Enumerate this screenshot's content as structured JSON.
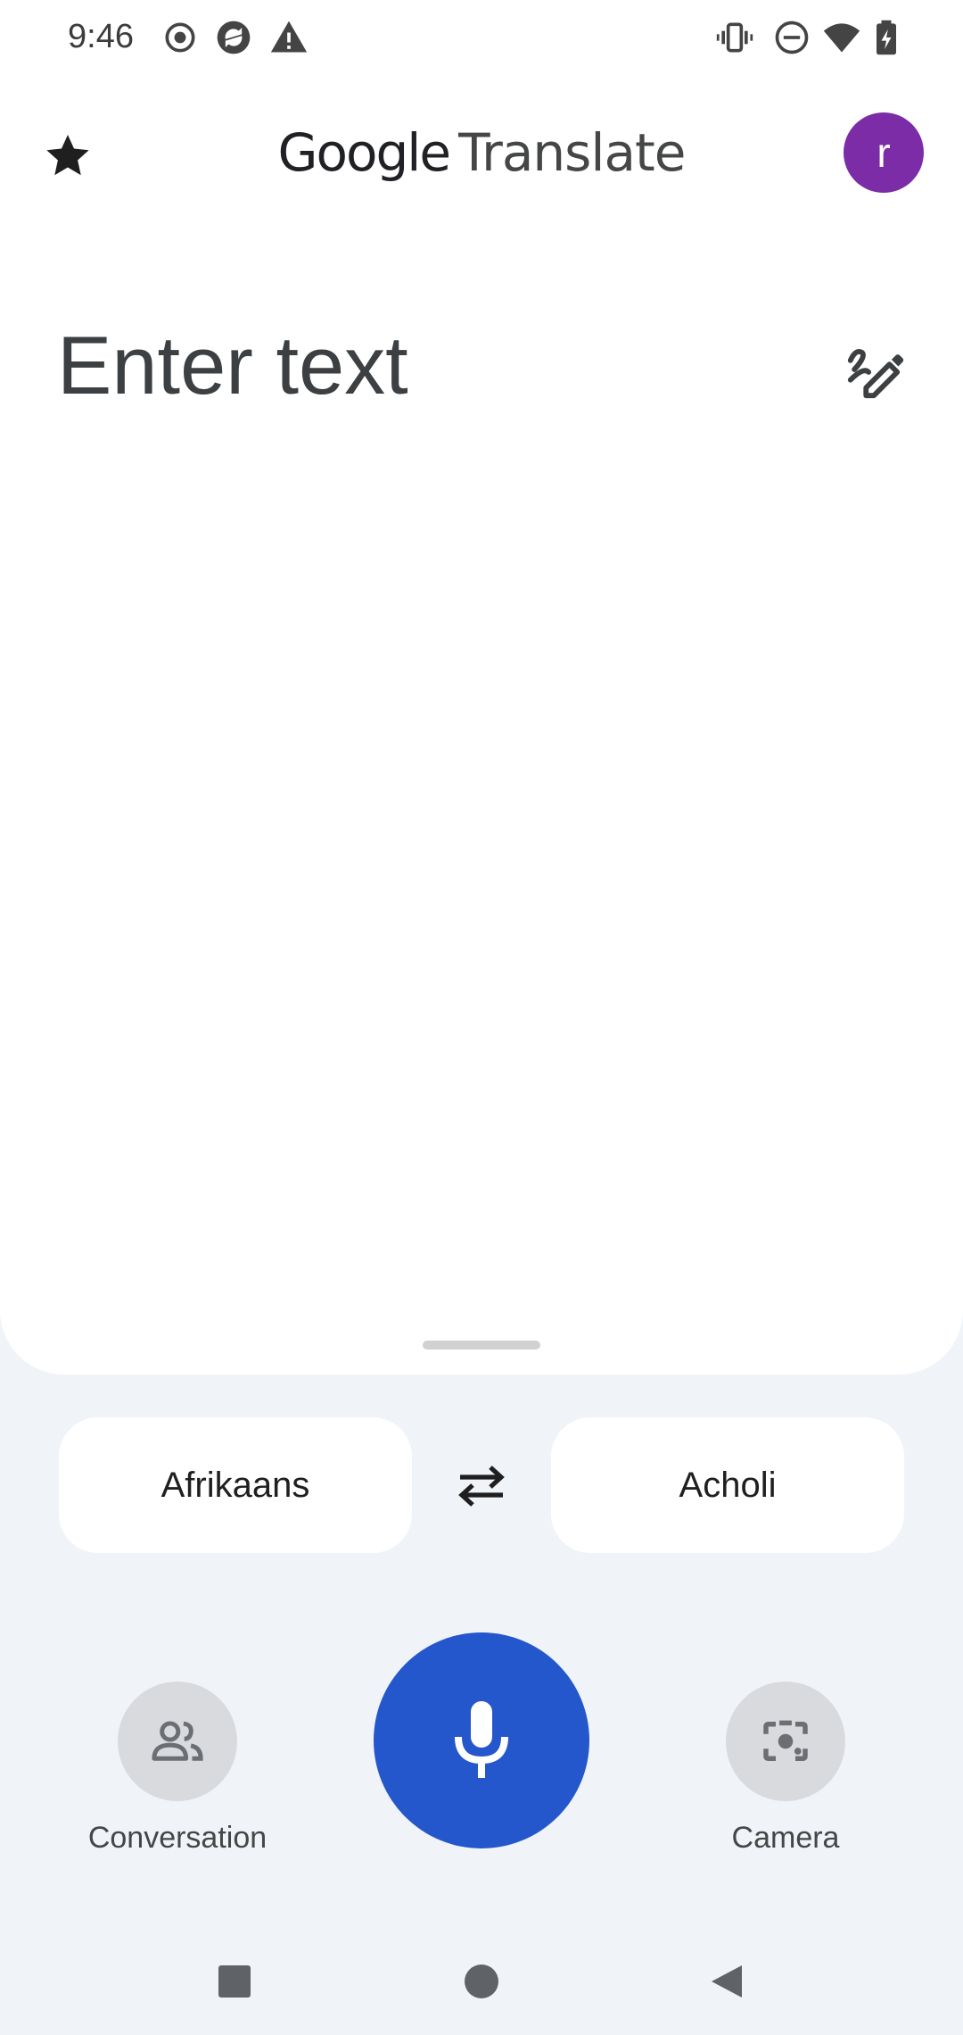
{
  "status_bar": {
    "time": "9:46",
    "left_icons": [
      "record-icon",
      "sync-icon",
      "warning-icon"
    ],
    "right_icons": [
      "vibrate-icon",
      "do-not-disturb-icon",
      "wifi-icon",
      "battery-charging-icon"
    ]
  },
  "app_bar": {
    "title_brand": "Google",
    "title_product": "Translate",
    "favorite_icon": "star-icon",
    "avatar_letter": "r",
    "avatar_color": "#7b2ca6"
  },
  "input": {
    "placeholder": "Enter text",
    "handwrite_icon": "handwriting-icon"
  },
  "languages": {
    "source": "Afrikaans",
    "target": "Acholi",
    "swap_icon": "swap-arrows-icon"
  },
  "actions": {
    "conversation_label": "Conversation",
    "camera_label": "Camera",
    "mic_icon": "microphone-icon",
    "mic_color": "#2557cc"
  },
  "nav": {
    "items": [
      "recents-icon",
      "home-icon",
      "back-icon"
    ]
  }
}
